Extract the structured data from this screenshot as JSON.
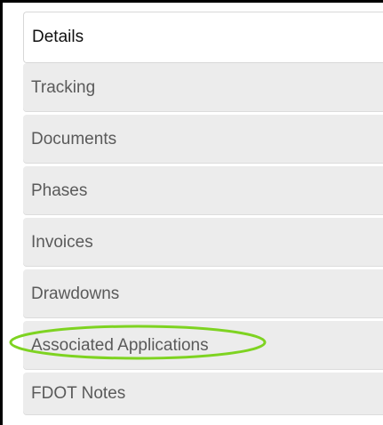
{
  "tabs": [
    {
      "label": "Details",
      "active": true
    },
    {
      "label": "Tracking",
      "active": false
    },
    {
      "label": "Documents",
      "active": false
    },
    {
      "label": "Phases",
      "active": false
    },
    {
      "label": "Invoices",
      "active": false
    },
    {
      "label": "Drawdowns",
      "active": false
    },
    {
      "label": "Associated Applications",
      "active": false,
      "highlighted": true
    },
    {
      "label": "FDOT Notes",
      "active": false
    }
  ],
  "colors": {
    "tab_inactive_bg": "#ececec",
    "tab_active_bg": "#ffffff",
    "tab_text": "#5a5a5a",
    "active_text": "#111111",
    "highlight": "#7ed321"
  }
}
